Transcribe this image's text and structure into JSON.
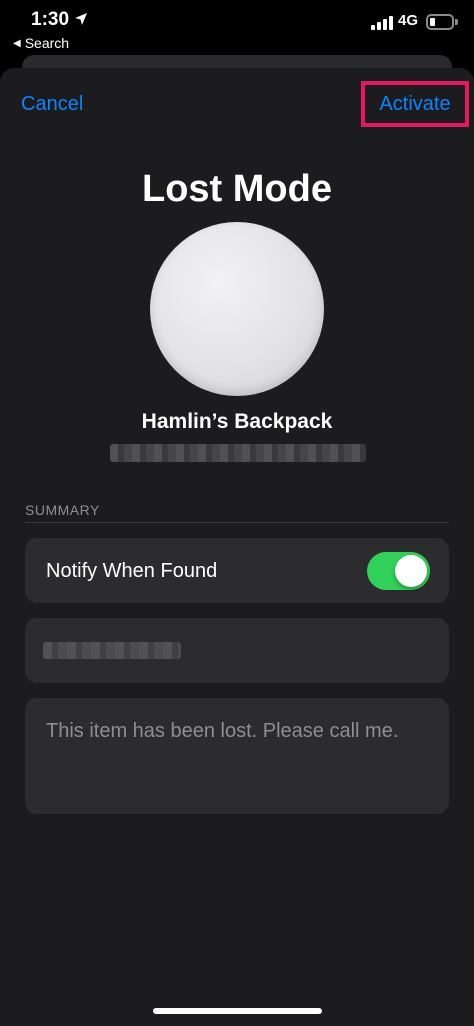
{
  "status_bar": {
    "time": "1:30",
    "back_label": "Search",
    "network": "4G",
    "icons": [
      "location-arrow-icon",
      "signal-icon",
      "battery-icon"
    ]
  },
  "nav": {
    "cancel_label": "Cancel",
    "activate_label": "Activate",
    "highlight_color": "#e8165f",
    "accent_color": "#0a84ff"
  },
  "page": {
    "title": "Lost Mode",
    "device_name": "Hamlin’s Backpack"
  },
  "summary": {
    "header": "SUMMARY",
    "notify_label": "Notify When Found",
    "notify_enabled": true,
    "toggle_color": "#30d158",
    "message": "This item has been lost. Please call me."
  }
}
